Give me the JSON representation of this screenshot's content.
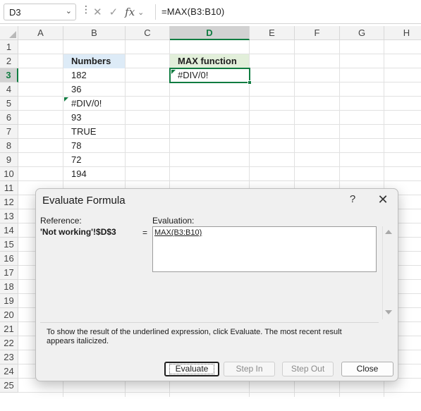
{
  "formula_bar": {
    "name_box": "D3",
    "formula": "=MAX(B3:B10)",
    "icons": [
      "more-vertical-icon",
      "cancel-icon",
      "enter-check-icon",
      "insert-function-icon"
    ]
  },
  "sheet": {
    "columns": [
      "A",
      "B",
      "C",
      "D",
      "E",
      "F",
      "G",
      "H"
    ],
    "selected_column": "D",
    "rows": [
      "1",
      "2",
      "3",
      "4",
      "5",
      "6",
      "7",
      "8",
      "9",
      "10",
      "11",
      "12",
      "13",
      "14",
      "15",
      "16",
      "17",
      "18",
      "19",
      "20",
      "21",
      "22",
      "23",
      "24",
      "25"
    ],
    "selected_row": "3",
    "b_header": "Numbers",
    "b_values": [
      "182",
      "36",
      "#DIV/0!",
      "93",
      "TRUE",
      "78",
      "72",
      "194"
    ],
    "d_header": "MAX function",
    "d_value": "#DIV/0!",
    "header_fill_b": "#ddebf7",
    "header_fill_d": "#e2efda",
    "selection_color": "#107c41"
  },
  "dialog": {
    "title": "Evaluate Formula",
    "help": "?",
    "close": "✕",
    "reference_label": "Reference:",
    "reference_value": "'Not working'!$D$3",
    "equals": "=",
    "evaluation_label": "Evaluation:",
    "evaluation_expr": "MAX(B3:B10)",
    "info": "To show the result of the underlined expression, click Evaluate.  The most recent result appears italicized.",
    "buttons": {
      "evaluate": "Evaluate",
      "step_in": "Step In",
      "step_out": "Step Out",
      "close": "Close"
    }
  }
}
